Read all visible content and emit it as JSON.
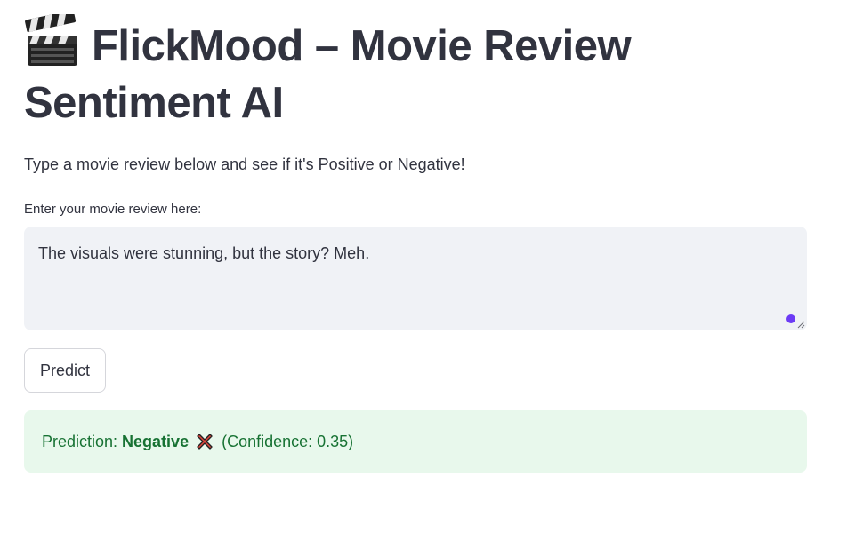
{
  "header": {
    "icon": "clapperboard-icon",
    "title": "FlickMood – Movie Review Sentiment AI"
  },
  "subtitle": "Type a movie review below and see if it's Positive or Negative!",
  "review": {
    "label": "Enter your movie review here:",
    "value": "The visuals were stunning, but the story? Meh."
  },
  "predict_button": {
    "label": "Predict"
  },
  "result": {
    "prefix": "Prediction:",
    "label": "Negative",
    "icon": "cross-mark-icon",
    "confidence_text": "(Confidence: 0.35)"
  },
  "colors": {
    "text": "#31333f",
    "input_bg": "#f0f2f6",
    "success_bg": "#e8f8ec",
    "success_text": "#177233",
    "focus_dot": "#6c3bf5",
    "cross": "#e0463c"
  }
}
